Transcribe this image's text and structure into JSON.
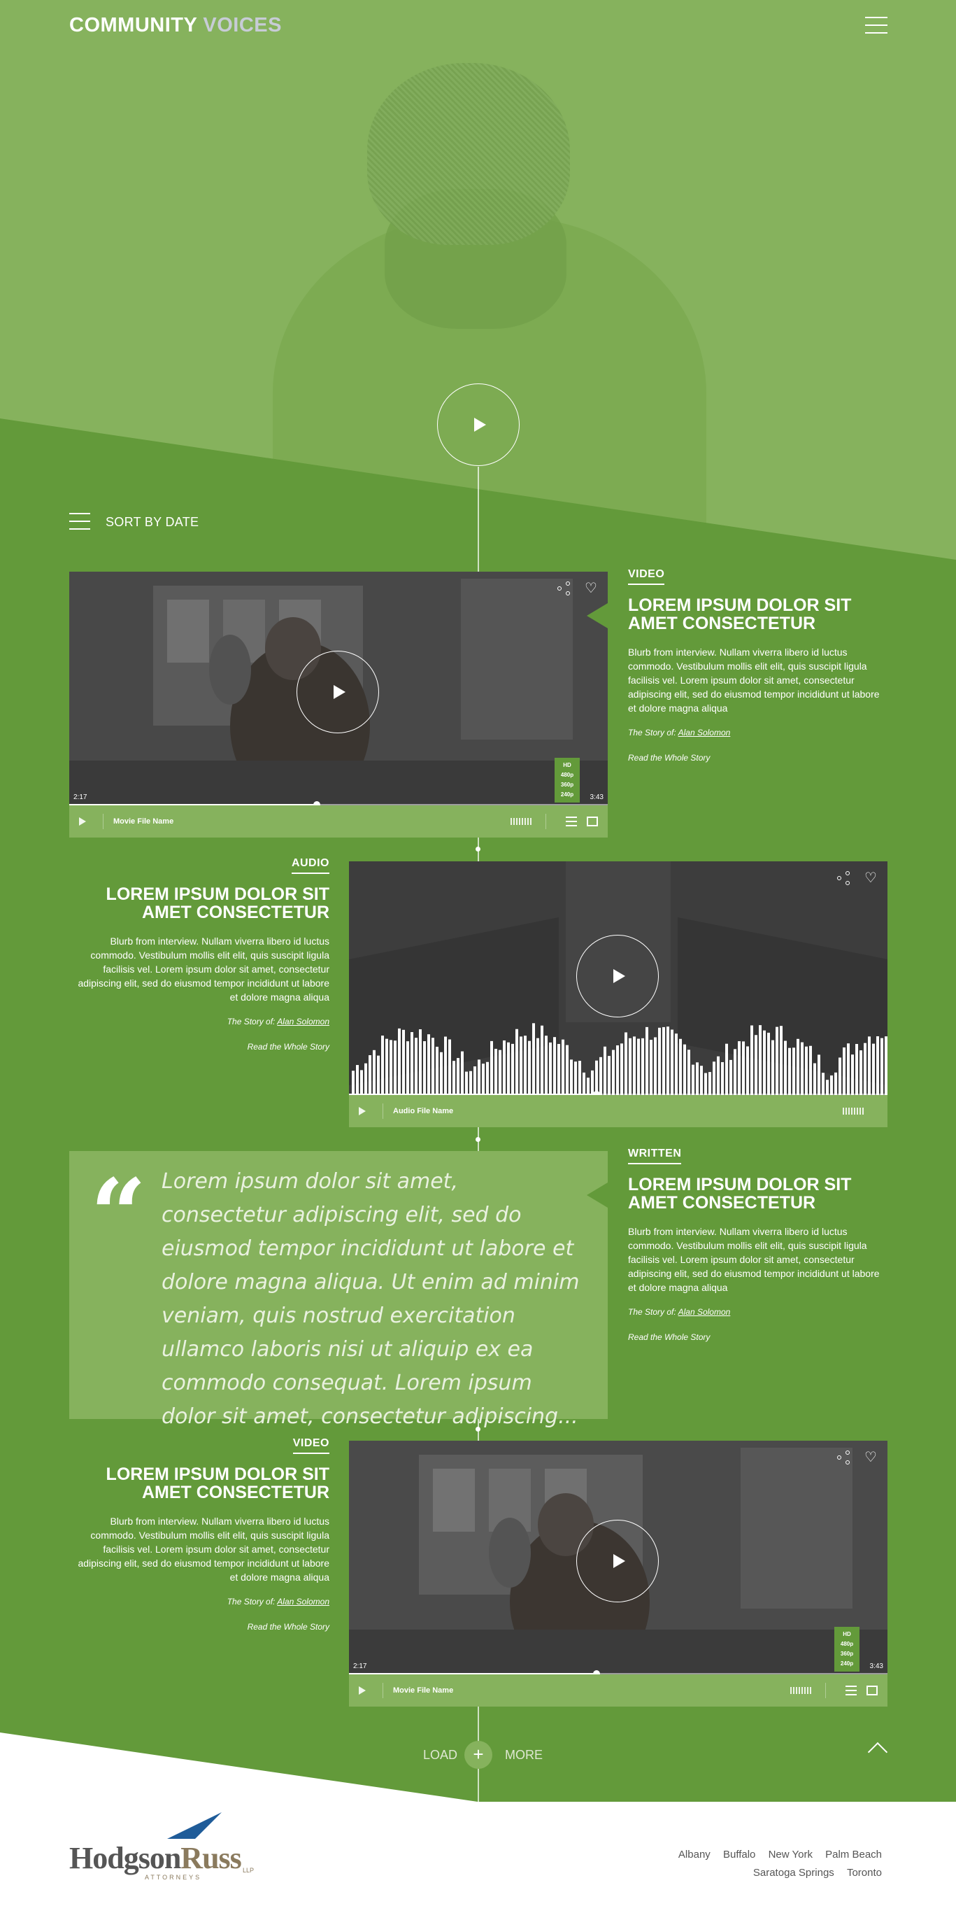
{
  "header": {
    "brand_part1": "COMMUNITY",
    "brand_part2": "VOICES"
  },
  "sort": {
    "label": "SORT BY DATE"
  },
  "stories": [
    {
      "category": "VIDEO",
      "title": "LOREM IPSUM DOLOR SIT AMET CONSECTETUR",
      "blurb": "Blurb from interview. Nullam viverra libero id luctus commodo. Vestibulum mollis elit elit, quis suscipit ligula facilisis vel. Lorem ipsum dolor sit amet, consectetur adipiscing elit, sed do eiusmod tempor incididunt ut labore et dolore magna aliqua",
      "byline_prefix": "The Story of:",
      "byline_name": "Alan Solomon",
      "read_more": "Read the Whole Story",
      "media": {
        "file_name": "Movie File Name",
        "time_current": "2:17",
        "time_total": "3:43",
        "progress": 0.46,
        "quality_options": [
          "HD",
          "480p",
          "360p",
          "240p"
        ]
      }
    },
    {
      "category": "AUDIO",
      "title": "LOREM IPSUM DOLOR SIT AMET CONSECTETUR",
      "blurb": "Blurb from interview. Nullam viverra libero id luctus commodo. Vestibulum mollis elit elit, quis suscipit ligula facilisis vel. Lorem ipsum dolor sit amet, consectetur adipiscing elit, sed do eiusmod tempor incididunt ut labore et dolore magna aliqua",
      "byline_prefix": "The Story of:",
      "byline_name": "Alan Solomon",
      "read_more": "Read the Whole Story",
      "media": {
        "file_name": "Audio File Name",
        "progress": 0.46
      }
    },
    {
      "category": "WRITTEN",
      "title": "LOREM IPSUM DOLOR SIT AMET CONSECTETUR",
      "blurb": "Blurb from interview. Nullam viverra libero id luctus commodo. Vestibulum mollis elit elit, quis suscipit ligula facilisis vel. Lorem ipsum dolor sit amet, consectetur adipiscing elit, sed do eiusmod tempor incididunt ut labore et dolore magna aliqua",
      "byline_prefix": "The Story of:",
      "byline_name": "Alan Solomon",
      "read_more": "Read the Whole Story",
      "quote": "Lorem ipsum dolor sit amet, consectetur adipiscing elit, sed do eiusmod tempor incididunt ut labore et dolore magna aliqua. Ut enim ad minim veniam, quis nostrud exercitation ullamco laboris nisi ut aliquip ex ea commodo consequat. Lorem ipsum dolor sit amet, consectetur adipiscing...",
      "quote_mark": "“"
    },
    {
      "category": "VIDEO",
      "title": "LOREM IPSUM DOLOR SIT AMET CONSECTETUR",
      "blurb": "Blurb from interview. Nullam viverra libero id luctus commodo. Vestibulum mollis elit elit, quis suscipit ligula facilisis vel. Lorem ipsum dolor sit amet, consectetur adipiscing elit, sed do eiusmod tempor incididunt ut labore et dolore magna aliqua",
      "byline_prefix": "The Story of:",
      "byline_name": "Alan Solomon",
      "read_more": "Read the Whole Story",
      "media": {
        "file_name": "Movie File Name",
        "time_current": "2:17",
        "time_total": "3:43",
        "progress": 0.46,
        "quality_options": [
          "HD",
          "480p",
          "360p",
          "240p"
        ]
      }
    }
  ],
  "load_more": {
    "left": "LOAD",
    "plus": "+",
    "right": "MORE"
  },
  "footer": {
    "logo_main": "Hodgson",
    "logo_second": "Russ",
    "logo_sub": "ATTORNEYS",
    "logo_llp": "LLP",
    "cities_row1": [
      "Albany",
      "Buffalo",
      "New York",
      "Palm Beach"
    ],
    "cities_row2": [
      "Saratoga Springs",
      "Toronto"
    ]
  },
  "colors": {
    "green_dark": "#639a3a",
    "green_light": "#86b25d",
    "white": "#ffffff"
  },
  "icons": {
    "menu": "hamburger-icon",
    "sort": "sort-list-icon",
    "share": "share-icon",
    "favorite": "heart-icon",
    "back_to_top": "chevron-up-icon"
  }
}
